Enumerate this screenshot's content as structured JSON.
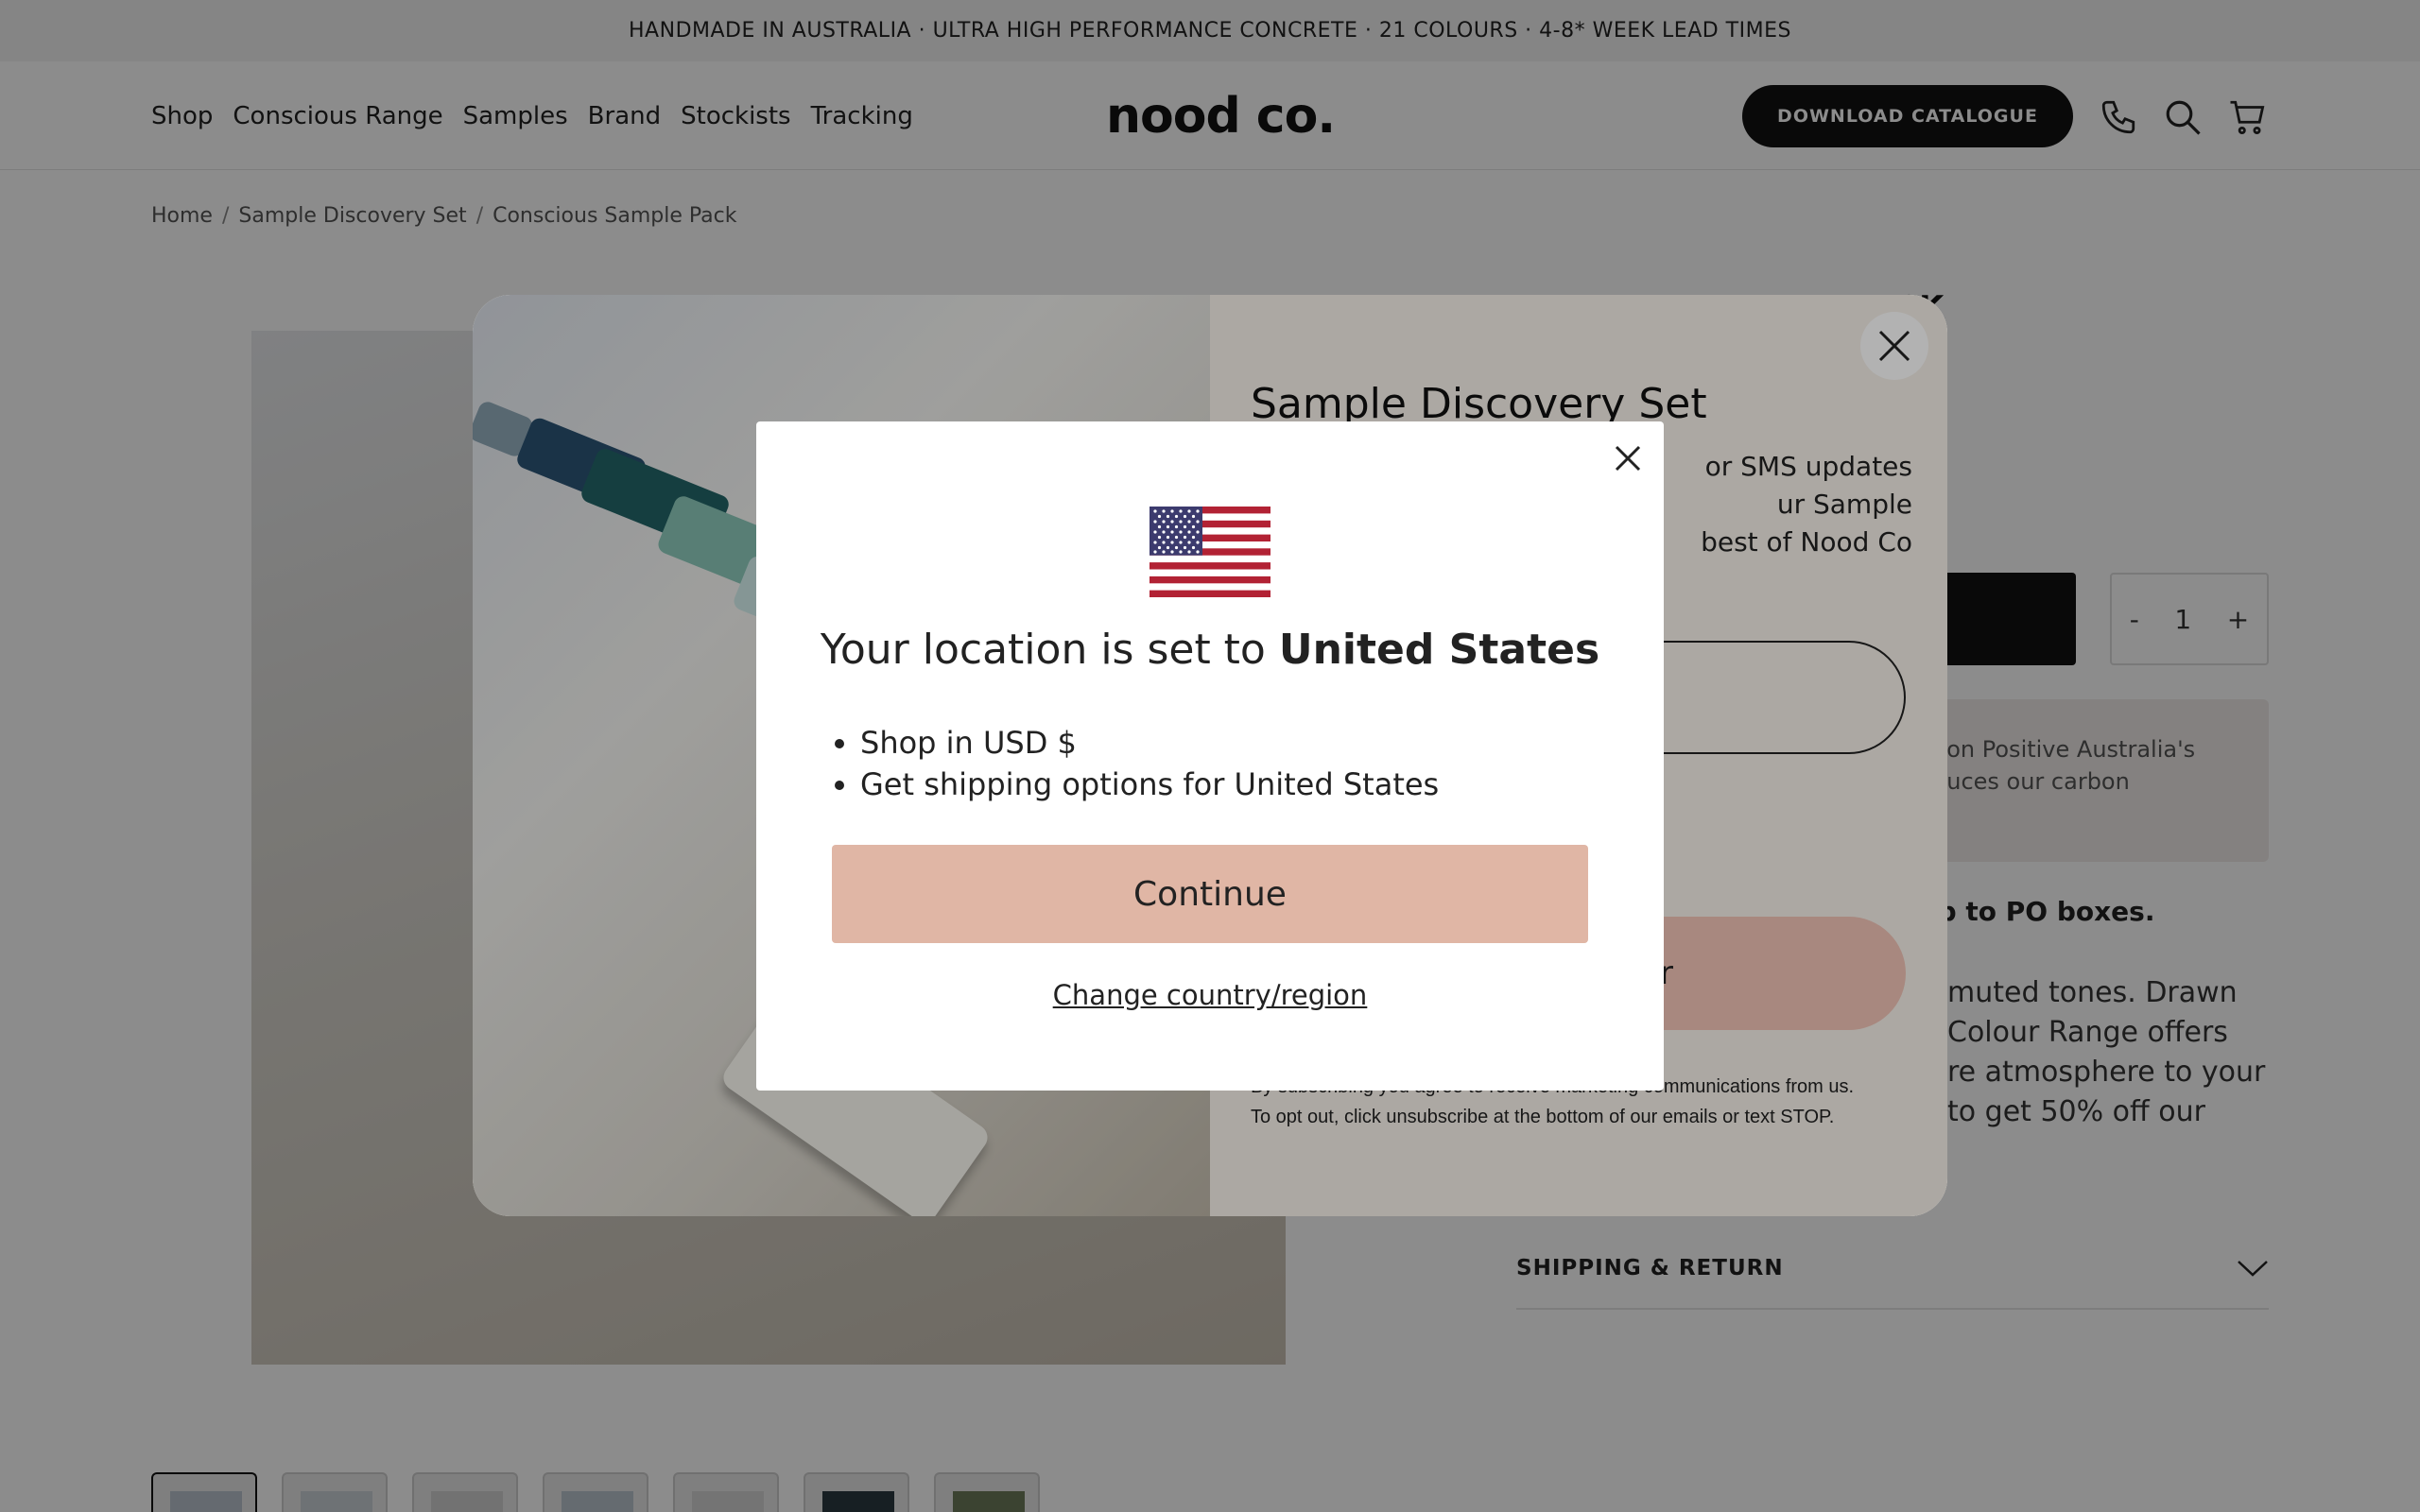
{
  "announcement": "HANDMADE IN AUSTRALIA · ULTRA HIGH PERFORMANCE CONCRETE · 21 COLOURS · 4-8* WEEK LEAD TIMES",
  "header": {
    "nav": [
      "Shop",
      "Conscious Range",
      "Samples",
      "Brand",
      "Stockists",
      "Tracking"
    ],
    "logo": "nood co.",
    "download_label": "DOWNLOAD CATALOGUE",
    "icons": [
      "phone-icon",
      "search-icon",
      "cart-icon"
    ]
  },
  "breadcrumb": [
    "Home",
    "Sample Discovery Set",
    "Conscious Sample Pack"
  ],
  "product": {
    "title_fragment": "CK",
    "quantity": {
      "minus": "-",
      "value": "1",
      "plus": "+"
    },
    "promo_text": "bon Positive Australia's\nduces our carbon",
    "shipping_note": "ip to PO boxes.",
    "description": "muted tones. Drawn\n Colour Range offers\nre atmosphere to your\n to get 50% off our",
    "accordion_label": "SHIPPING & RETURN",
    "thumbnail_count": 7
  },
  "signup_popup": {
    "title": "Sample Discovery Set",
    "subtitle": "or SMS updates\nur Sample\nbest of Nood Co",
    "submit_label": "er",
    "legal_line1": "By subscribing you agree to receive marketing communications from us.",
    "legal_line2": "To opt out, click unsubscribe at the bottom of our emails or text STOP."
  },
  "geo_modal": {
    "title_prefix": "Your location is set to ",
    "country": "United States",
    "bullets": [
      "Shop in USD $",
      "Get shipping options for United States"
    ],
    "continue_label": "Continue",
    "change_label": "Change country/region",
    "flag_icon": "us-flag-icon"
  },
  "colors": {
    "accent_peach": "#e0b6a5",
    "dark": "#111111",
    "overlay": "rgba(0,0,0,0.45)"
  }
}
